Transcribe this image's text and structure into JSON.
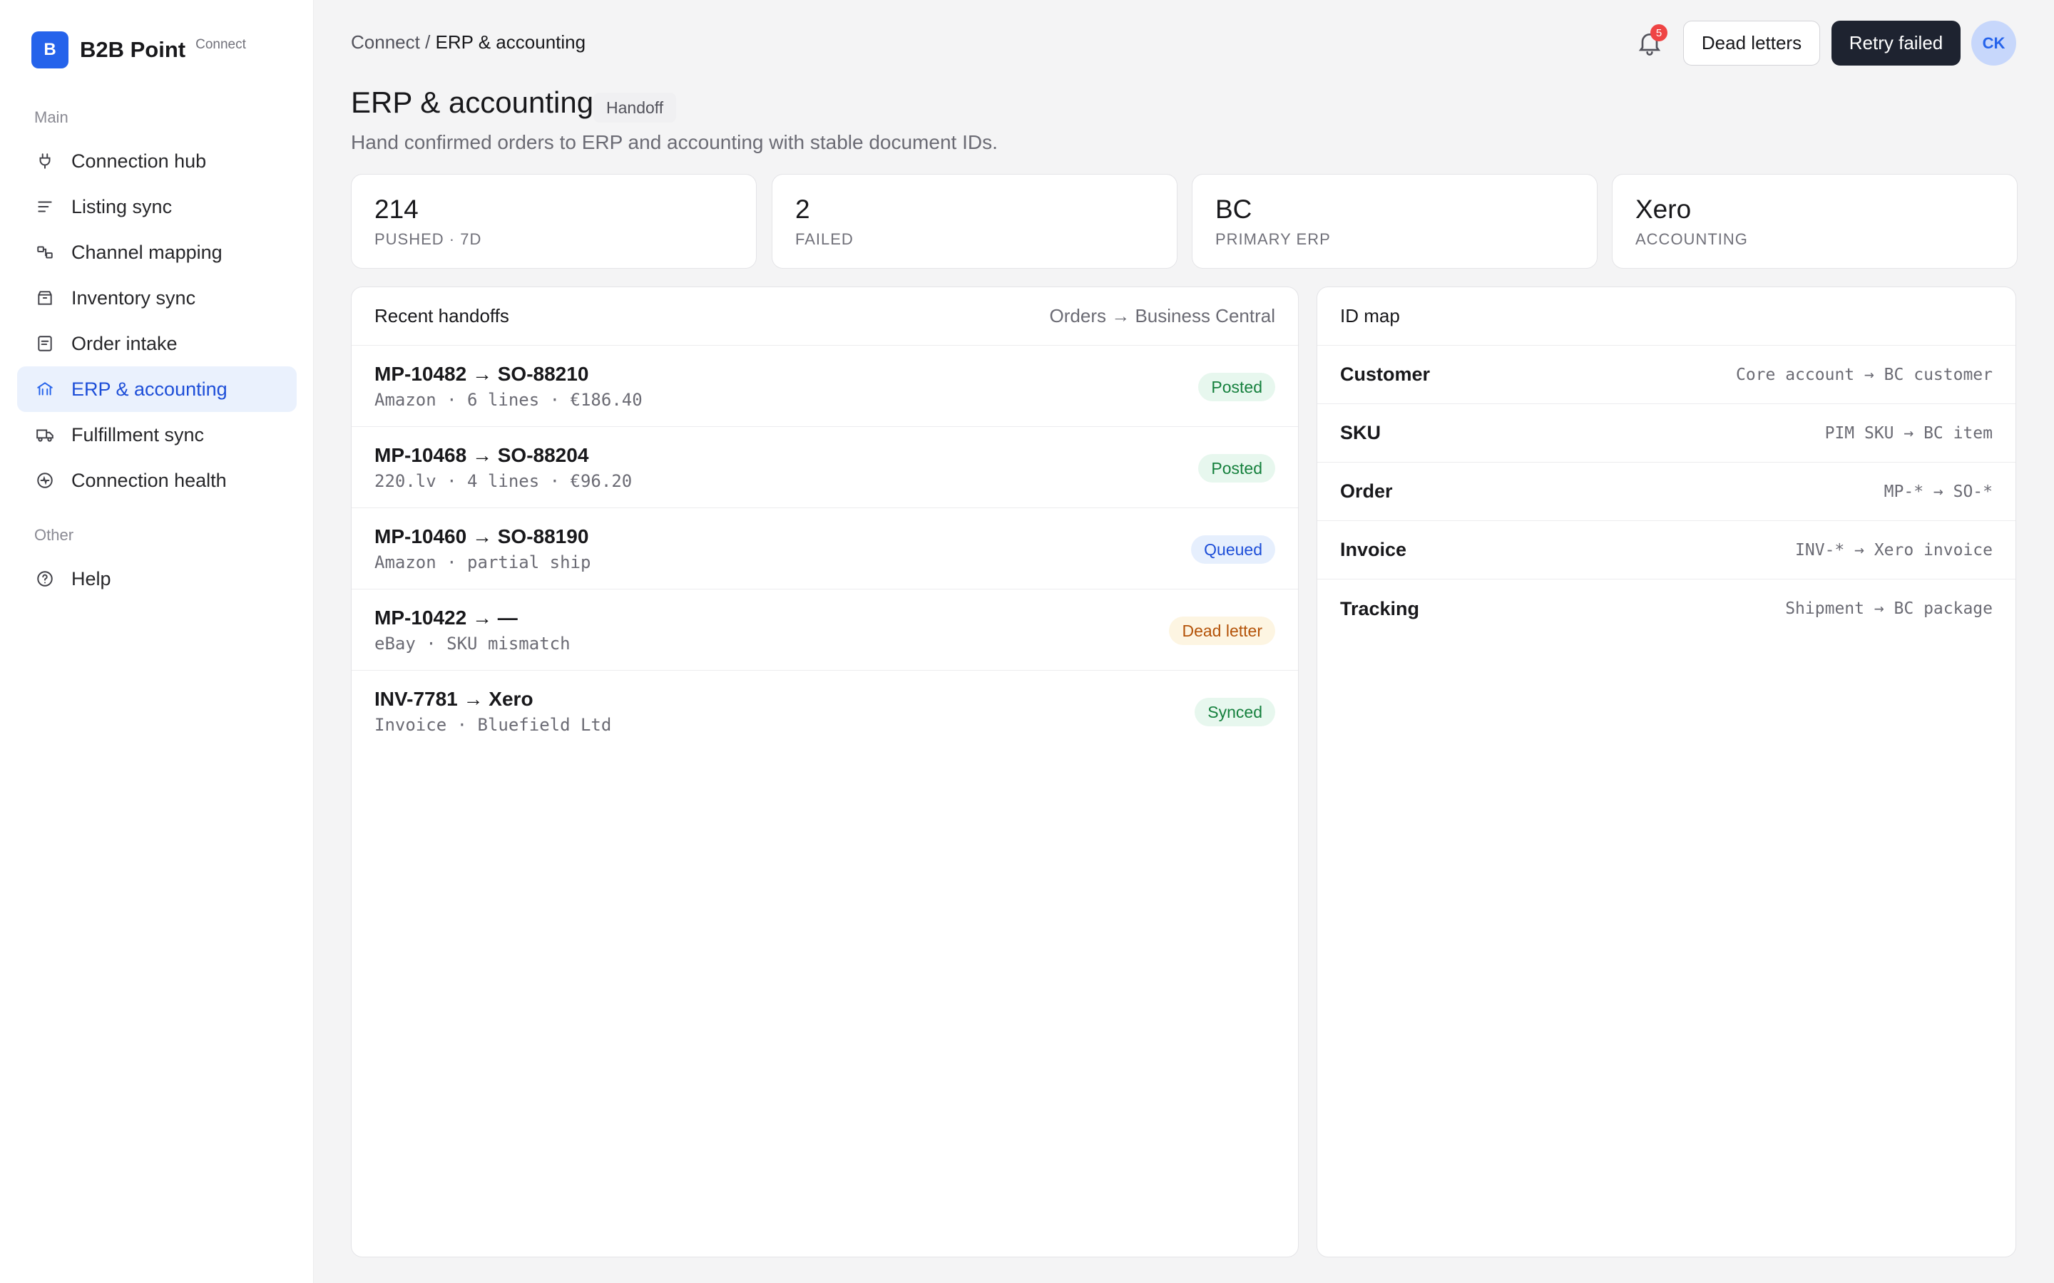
{
  "brand": {
    "logo_letter": "B",
    "name": "B2B Point",
    "tag": "Connect"
  },
  "sidebar": {
    "section_main": "Main",
    "section_other": "Other",
    "items": [
      {
        "label": "Connection hub",
        "icon": "plug-icon"
      },
      {
        "label": "Listing sync",
        "icon": "list-icon"
      },
      {
        "label": "Channel mapping",
        "icon": "mapping-icon"
      },
      {
        "label": "Inventory sync",
        "icon": "box-icon"
      },
      {
        "label": "Order intake",
        "icon": "document-icon"
      },
      {
        "label": "ERP & accounting",
        "icon": "bank-icon",
        "active": true
      },
      {
        "label": "Fulfillment sync",
        "icon": "truck-icon"
      },
      {
        "label": "Connection health",
        "icon": "pulse-icon"
      }
    ],
    "help": {
      "label": "Help",
      "icon": "help-icon"
    }
  },
  "topbar": {
    "crumb_root": "Connect /",
    "crumb_current": "ERP & accounting",
    "notifications_count": "5",
    "dead_letters_label": "Dead letters",
    "retry_label": "Retry failed",
    "avatar_initials": "CK"
  },
  "page": {
    "title": "ERP & accounting",
    "badge": "Handoff",
    "subtitle": "Hand confirmed orders to ERP and accounting with stable document IDs."
  },
  "stats": [
    {
      "value": "214",
      "label": "PUSHED · 7D"
    },
    {
      "value": "2",
      "label": "FAILED"
    },
    {
      "value": "BC",
      "label": "PRIMARY ERP"
    },
    {
      "value": "Xero",
      "label": "ACCOUNTING"
    }
  ],
  "handoffs": {
    "title": "Recent handoffs",
    "meta": "Orders → Business Central",
    "rows": [
      {
        "title": "MP-10482 → SO-88210",
        "sub": "Amazon · 6 lines · €186.40",
        "status": "Posted",
        "tone": "green"
      },
      {
        "title": "MP-10468 → SO-88204",
        "sub": "220.lv · 4 lines · €96.20",
        "status": "Posted",
        "tone": "green"
      },
      {
        "title": "MP-10460 → SO-88190",
        "sub": "Amazon · partial ship",
        "status": "Queued",
        "tone": "blue"
      },
      {
        "title": "MP-10422 → —",
        "sub": "eBay · SKU mismatch",
        "status": "Dead letter",
        "tone": "amber"
      },
      {
        "title": "INV-7781 → Xero",
        "sub": "Invoice · Bluefield Ltd",
        "status": "Synced",
        "tone": "green"
      }
    ]
  },
  "idmap": {
    "title": "ID map",
    "rows": [
      {
        "key": "Customer",
        "value": "Core account → BC customer"
      },
      {
        "key": "SKU",
        "value": "PIM SKU → BC item"
      },
      {
        "key": "Order",
        "value": "MP-* → SO-*"
      },
      {
        "key": "Invoice",
        "value": "INV-* → Xero invoice"
      },
      {
        "key": "Tracking",
        "value": "Shipment → BC package"
      }
    ]
  },
  "colors": {
    "accent": "#2563eb",
    "dark_button": "#1e2330",
    "posted": "#15803d",
    "queued": "#1d4ed8",
    "dead_letter": "#b45309"
  }
}
